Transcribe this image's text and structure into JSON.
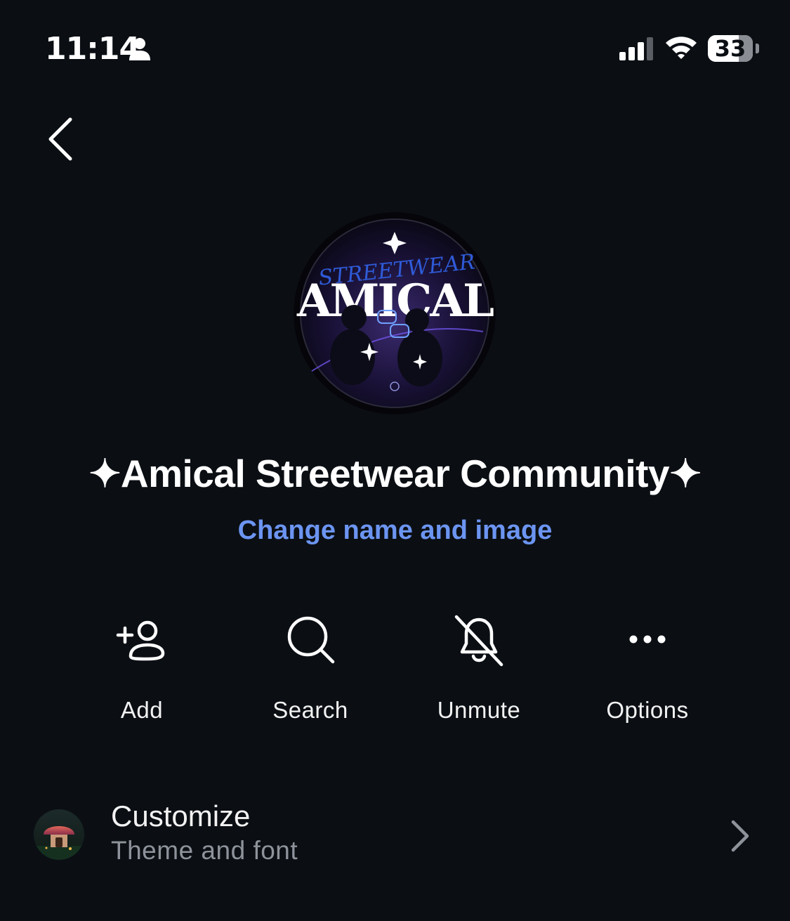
{
  "status_bar": {
    "time": "11:14",
    "battery": "33",
    "icons": [
      "person-icon",
      "cellular-signal-icon",
      "wifi-icon",
      "battery-icon"
    ]
  },
  "nav": {
    "back_icon": "chevron-left-icon"
  },
  "group": {
    "name": "✦Amical Streetwear Community✦",
    "change_link": "Change name and image",
    "avatar_logo_text": "AMICAL",
    "avatar_logo_script": "STREETWEAR"
  },
  "actions": [
    {
      "label": "Add",
      "icon": "add-person-icon"
    },
    {
      "label": "Search",
      "icon": "search-icon"
    },
    {
      "label": "Unmute",
      "icon": "bell-slash-icon"
    },
    {
      "label": "Options",
      "icon": "more-icon"
    }
  ],
  "customize": {
    "title": "Customize",
    "subtitle": "Theme and font",
    "chevron_icon": "chevron-right-icon"
  },
  "colors": {
    "background": "#0b0f14",
    "link": "#6c95f2",
    "secondary_text": "#8e939b"
  }
}
